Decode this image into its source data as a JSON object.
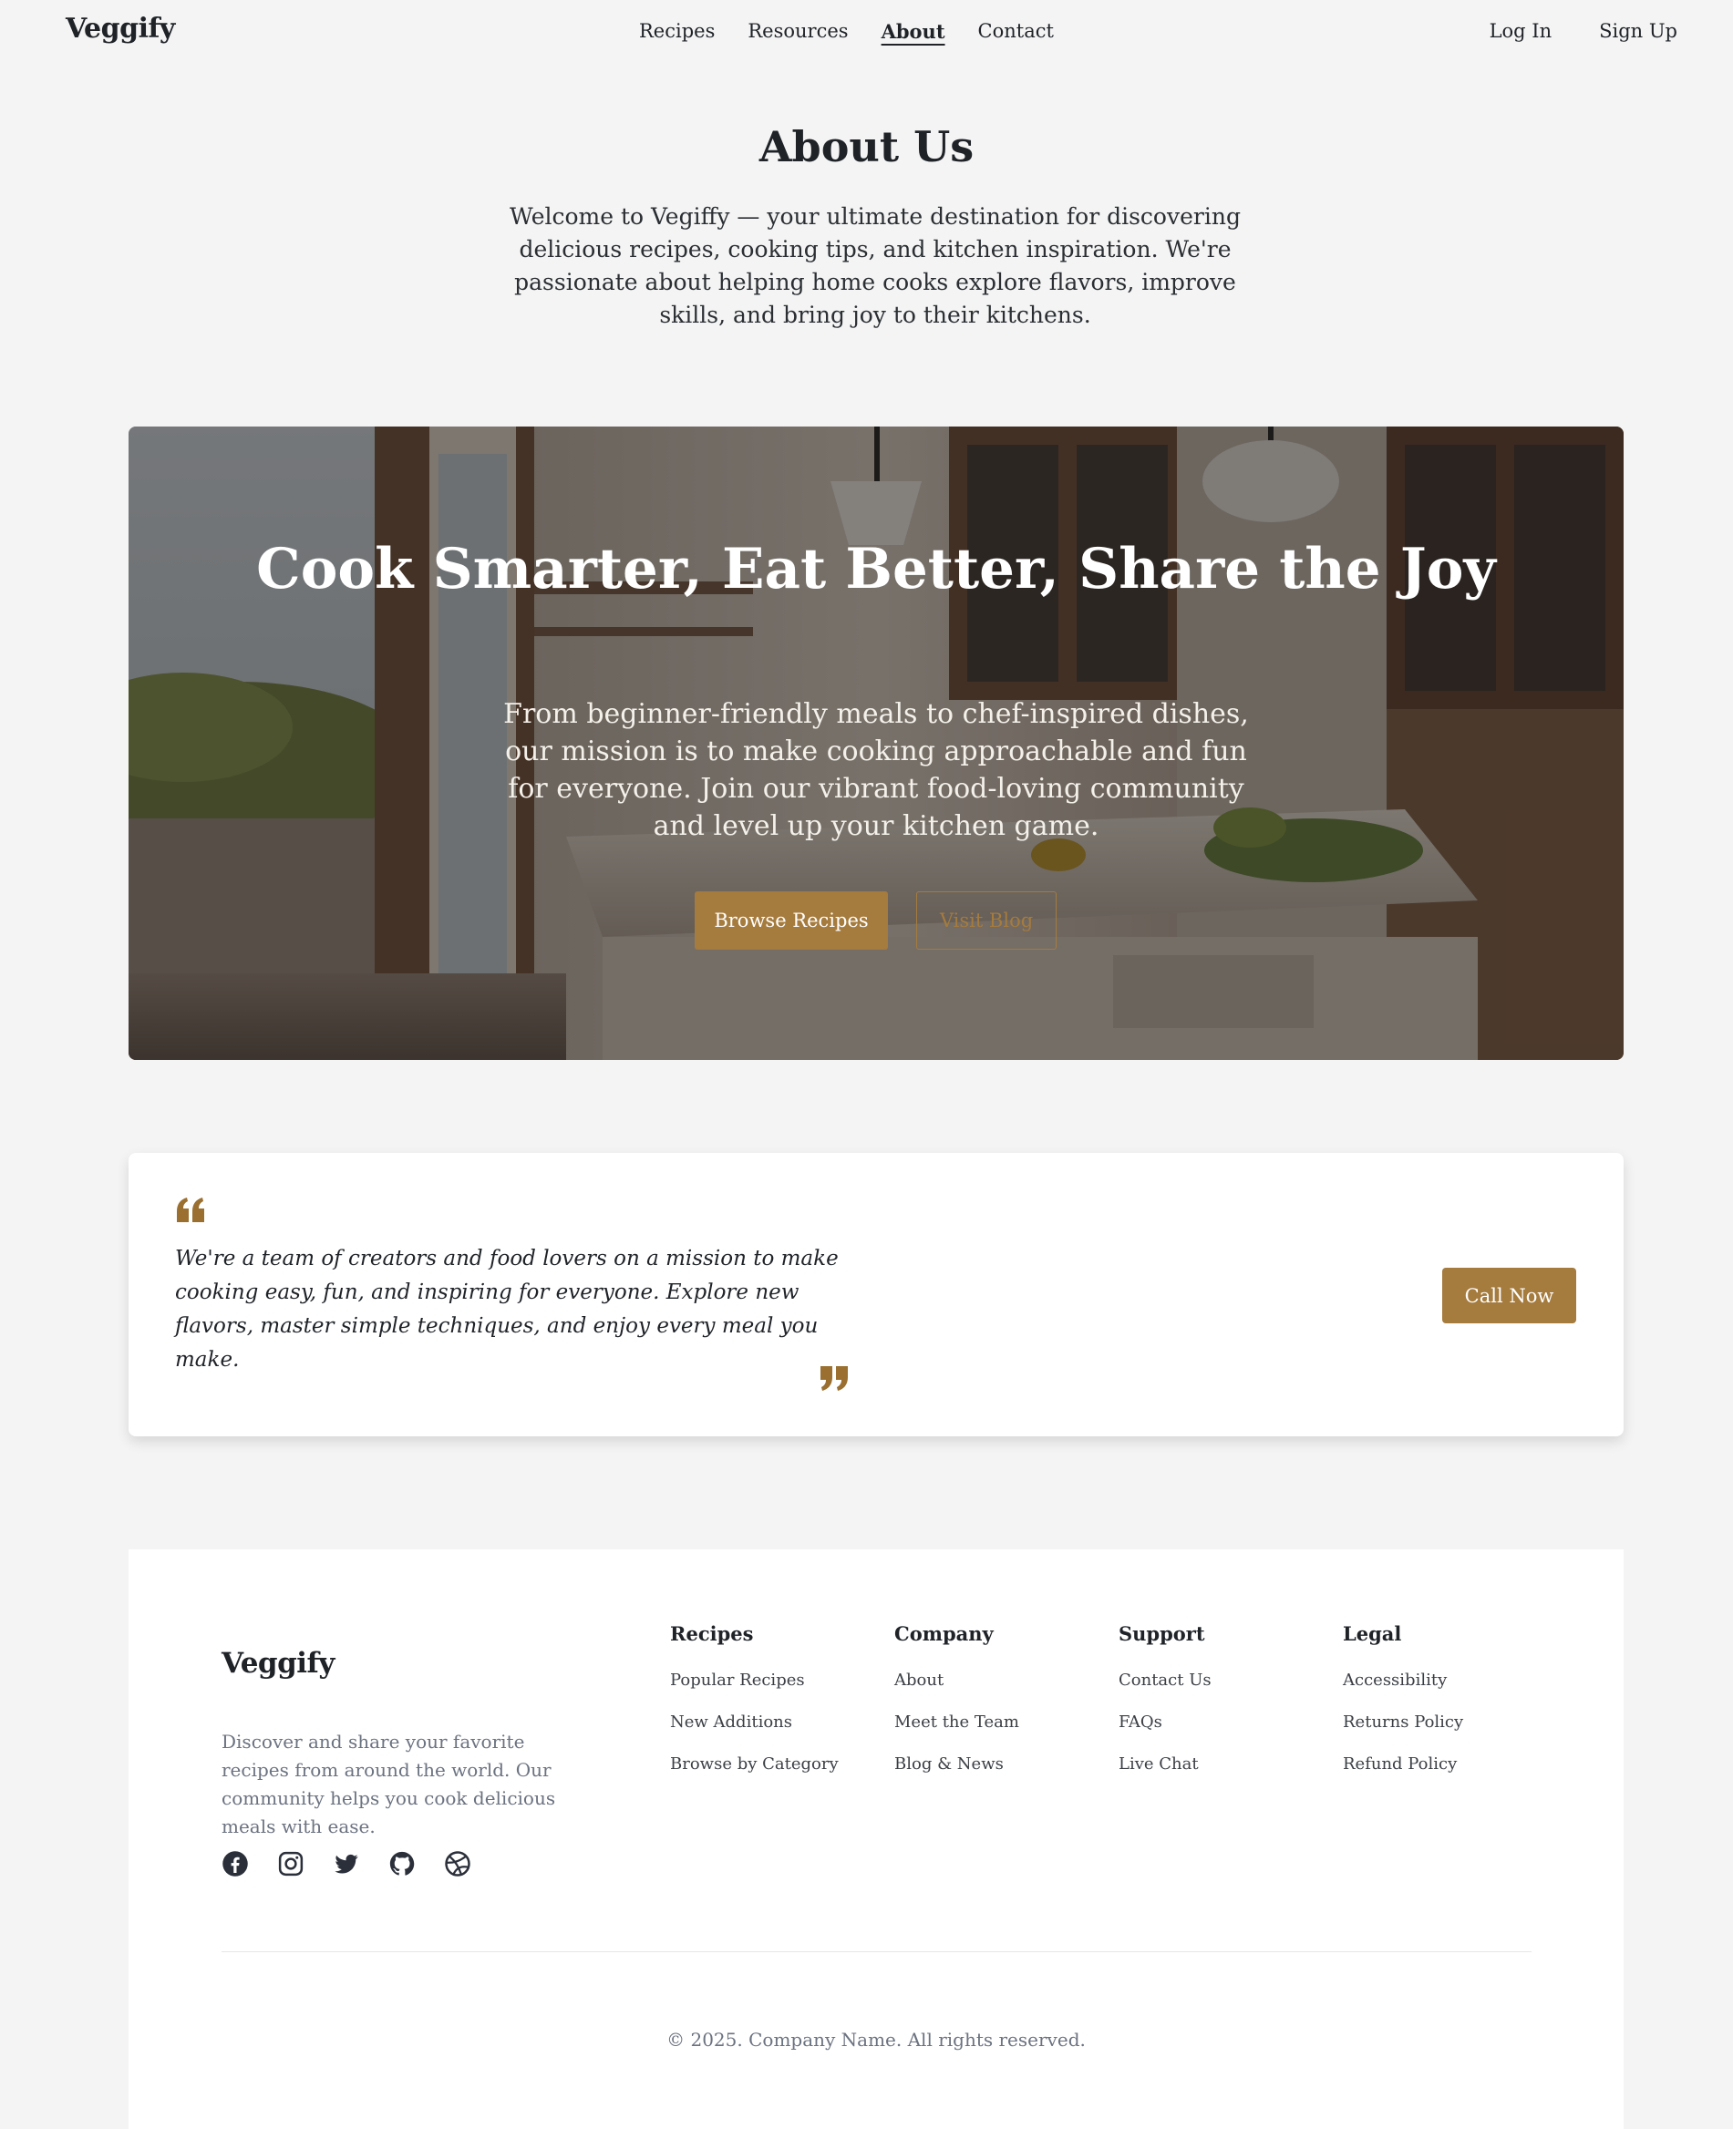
{
  "nav": {
    "logo": "Veggify",
    "links": [
      "Recipes",
      "Resources",
      "About",
      "Contact"
    ],
    "active": "About",
    "login": "Log In",
    "signup": "Sign Up"
  },
  "about": {
    "title": "About Us",
    "intro": "Welcome to Vegiffy — your ultimate destination for discovering delicious recipes, cooking tips, and kitchen inspiration. We're passionate about helping home cooks explore flavors, improve skills, and bring joy to their kitchens."
  },
  "hero": {
    "title": "Cook Smarter, Eat Better, Share the Joy",
    "text": "From beginner-friendly meals to chef-inspired dishes, our mission is to make cooking approachable and fun for everyone. Join our vibrant food-loving community and level up your kitchen game.",
    "primary_button": "Browse Recipes",
    "secondary_button": "Visit Blog"
  },
  "quote": {
    "text": "We're a team of creators and food lovers on a mission to make cooking easy, fun, and inspiring for everyone. Explore new flavors, master simple techniques, and enjoy every meal you make.",
    "button": "Call Now"
  },
  "footer": {
    "logo": "Veggify",
    "description": "Discover and share your favorite recipes from around the world. Our community helps you cook delicious meals with ease.",
    "socials": [
      "facebook-icon",
      "instagram-icon",
      "twitter-icon",
      "github-icon",
      "dribbble-icon"
    ],
    "columns": [
      {
        "title": "Recipes",
        "links": [
          "Popular Recipes",
          "New Additions",
          "Browse by Category"
        ]
      },
      {
        "title": "Company",
        "links": [
          "About",
          "Meet the Team",
          "Blog & News"
        ]
      },
      {
        "title": "Support",
        "links": [
          "Contact Us",
          "FAQs",
          "Live Chat"
        ]
      },
      {
        "title": "Legal",
        "links": [
          "Accessibility",
          "Returns Policy",
          "Refund Policy"
        ]
      }
    ],
    "copyright": "© 2025. Company Name. All rights reserved."
  },
  "colors": {
    "accent": "#a57b3e",
    "background": "#f4f4f4",
    "text": "#1f2328"
  }
}
